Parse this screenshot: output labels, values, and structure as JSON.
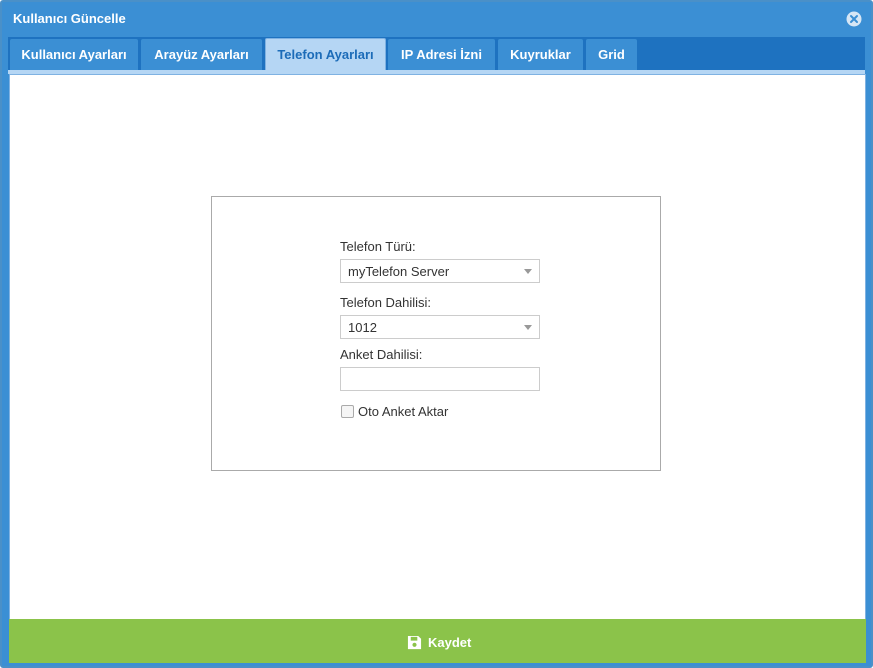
{
  "dialog": {
    "title": "Kullanıcı Güncelle",
    "close_icon": "close-circle-icon"
  },
  "tabs": [
    {
      "label": "Kullanıcı Ayarları",
      "active": false
    },
    {
      "label": "Arayüz Ayarları",
      "active": false
    },
    {
      "label": "Telefon Ayarları",
      "active": true
    },
    {
      "label": "IP Adresi İzni",
      "active": false
    },
    {
      "label": "Kuyruklar",
      "active": false
    },
    {
      "label": "Grid",
      "active": false
    }
  ],
  "form": {
    "phone_type_label": "Telefon Türü:",
    "phone_type_value": "myTelefon Server",
    "phone_ext_label": "Telefon Dahilisi:",
    "phone_ext_value": "1012",
    "survey_ext_label": "Anket Dahilisi:",
    "survey_ext_value": "",
    "auto_survey_label": "Oto Anket Aktar",
    "auto_survey_checked": false
  },
  "footer": {
    "save_label": "Kaydet",
    "save_icon": "floppy-disk-icon"
  },
  "colors": {
    "header": "#3b8fd4",
    "tab_active_bg": "#b5d6f4",
    "tab_active_text": "#1c6cb8",
    "footer": "#8bc34a"
  }
}
